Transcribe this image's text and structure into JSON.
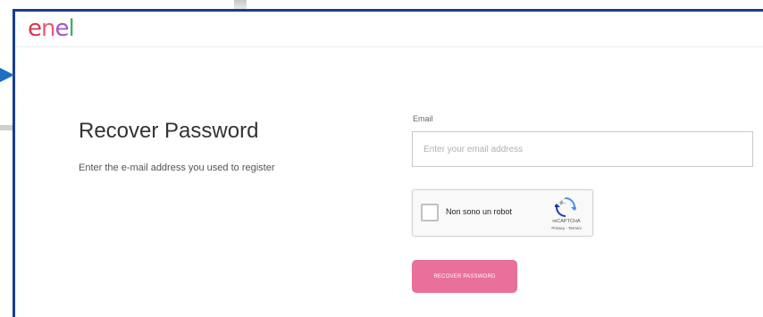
{
  "brand": {
    "logo_text_parts": [
      "e",
      "n",
      "e",
      "l"
    ],
    "colors": [
      "#d2394e",
      "#e85a7a",
      "#a455c8",
      "#3fae6a"
    ]
  },
  "page": {
    "title": "Recover Password",
    "subtitle": "Enter the e-mail address you used to register"
  },
  "form": {
    "email_label": "Email",
    "email_placeholder": "Enter your email address",
    "email_value": ""
  },
  "recaptcha": {
    "label": "Non sono un robot",
    "brand": "reCAPTCHA",
    "terms": "Privacy - Termini",
    "checked": false
  },
  "button": {
    "label": "RECOVER PASSWORD",
    "color": "#e8709b"
  },
  "icons": {
    "recaptcha": "recaptcha-logo-icon",
    "pointer": "pointer-arrow-icon"
  }
}
